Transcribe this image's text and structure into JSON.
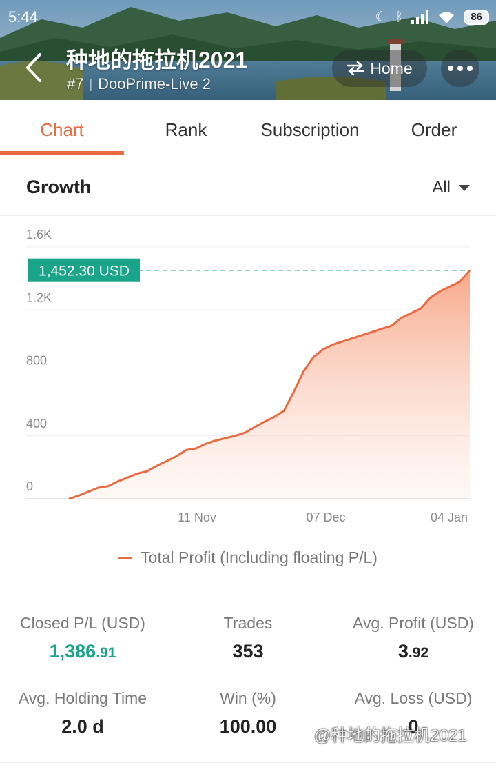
{
  "status_bar": {
    "time": "5:44",
    "battery": "86"
  },
  "header": {
    "title": "种地的拖拉机2021",
    "rank": "#7",
    "server": "DooPrime-Live 2",
    "home_label": "Home"
  },
  "tabs": [
    {
      "label": "Chart",
      "active": true
    },
    {
      "label": "Rank",
      "active": false
    },
    {
      "label": "Subscription",
      "active": false
    },
    {
      "label": "Order",
      "active": false
    }
  ],
  "growth": {
    "title": "Growth",
    "range": "All"
  },
  "chart_data": {
    "type": "area",
    "current_value_label": "1,452.30 USD",
    "current_value": 1452.3,
    "ylim": [
      0,
      1600
    ],
    "ytick_labels": [
      "0",
      "400",
      "800",
      "1.2K",
      "1.6K"
    ],
    "xtick_labels": [
      "11 Nov",
      "07 Dec",
      "04 Jan"
    ],
    "series": [
      {
        "name": "Total Profit (Including floating P/L)",
        "color": "#ec6a3f",
        "values": [
          0,
          20,
          45,
          70,
          80,
          110,
          135,
          160,
          175,
          210,
          240,
          270,
          310,
          320,
          350,
          370,
          385,
          400,
          420,
          455,
          490,
          520,
          560,
          680,
          810,
          900,
          950,
          980,
          1000,
          1020,
          1040,
          1060,
          1080,
          1100,
          1150,
          1180,
          1210,
          1280,
          1320,
          1350,
          1380,
          1452.3
        ]
      }
    ]
  },
  "stats": {
    "closed_pl": {
      "label": "Closed P/L (USD)",
      "int": "1,386",
      "dec": ".91",
      "color": "#1aa58a"
    },
    "trades": {
      "label": "Trades",
      "value": "353"
    },
    "avg_profit": {
      "label": "Avg. Profit (USD)",
      "int": "3",
      "dec": ".92"
    },
    "avg_holding": {
      "label": "Avg. Holding Time",
      "value": "2.0 d"
    },
    "win": {
      "label": "Win (%)",
      "value": "100.00"
    },
    "avg_loss": {
      "label": "Avg. Loss (USD)",
      "value": "0"
    }
  },
  "watermark": "@种地的拖拉机2021",
  "icons": [
    "back-arrow-icon",
    "swap-icon",
    "more-dots-icon",
    "moon-icon",
    "bluetooth-icon",
    "signal-icon",
    "wifi-icon",
    "caret-down-icon"
  ]
}
